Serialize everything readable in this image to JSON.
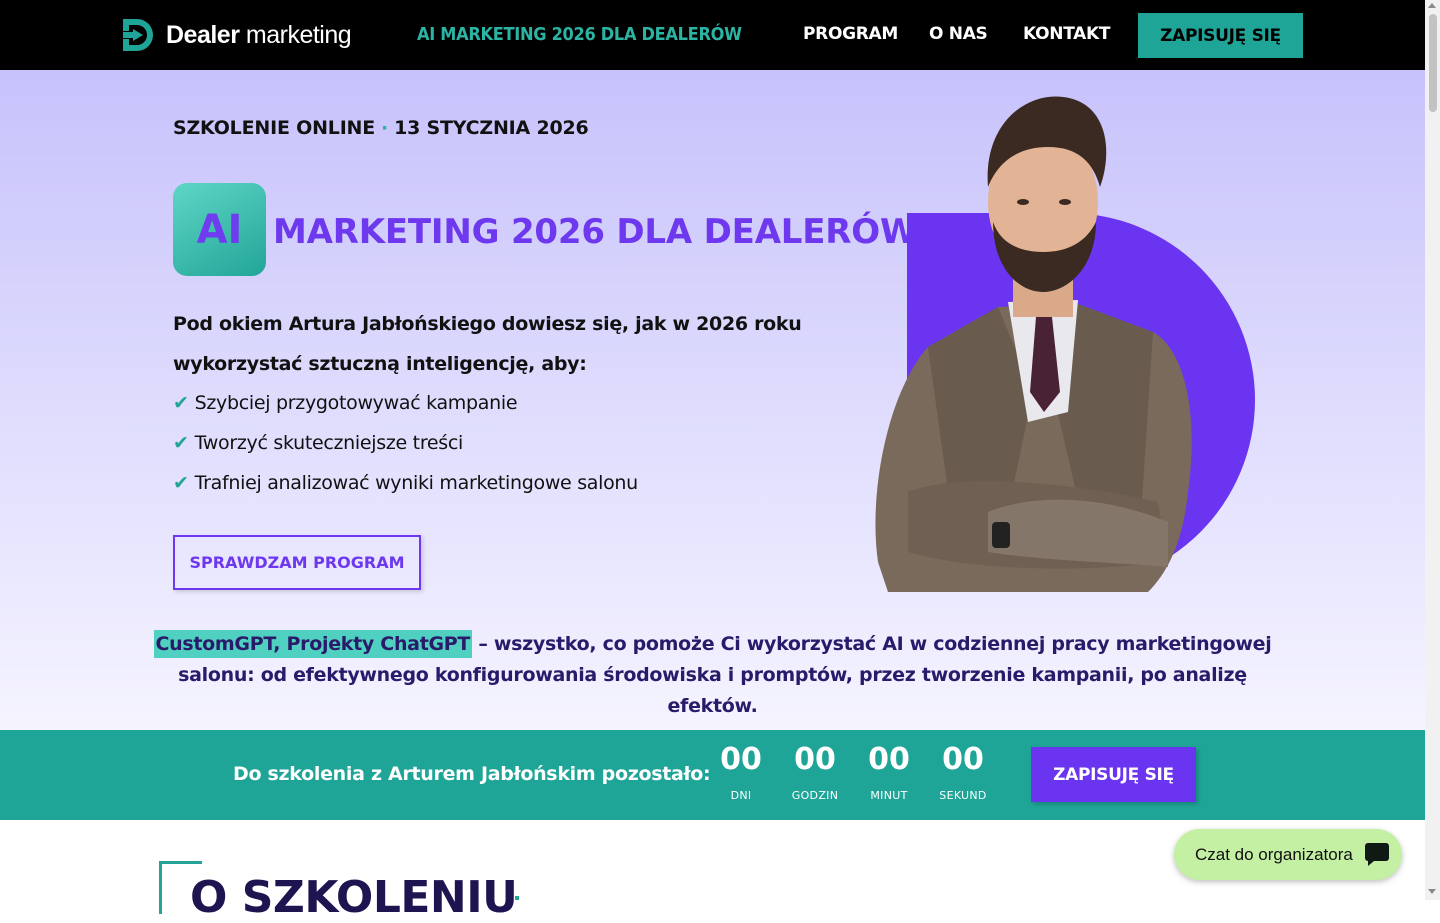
{
  "header": {
    "logo_bold": "Dealer",
    "logo_light": "marketing",
    "center_link": "AI MARKETING 2026 DLA DEALERÓW",
    "nav": [
      "PROGRAM",
      "O NAS",
      "KONTAKT"
    ],
    "cta": "ZAPISUJĘ SIĘ"
  },
  "hero": {
    "eyebrow_left": "SZKOLENIE ONLINE",
    "eyebrow_sep": "·",
    "eyebrow_right": "13 STYCZNIA 2026",
    "badge": "AI",
    "title": "MARKETING 2026 DLA DEALERÓW",
    "lead": "Pod okiem Artura Jabłońskiego dowiesz się, jak w 2026 roku wykorzystać sztuczną inteligencję, aby:",
    "bullet_icon": "✔",
    "bullets": [
      "Szybciej przygotowywać kampanie",
      "Tworzyć skuteczniejsze treści",
      "Trafniej analizować wyniki marketingowe salonu"
    ],
    "program_button": "SPRAWDZAM PROGRAM",
    "tagline_highlight": "CustomGPT, Projekty ChatGPT",
    "tagline_rest": " – wszystko, co pomoże Ci wykorzystać AI w codziennej pracy marketingowej salonu: od efektywnego konfigurowania środowiska i promptów, przez tworzenie kampanii, po analizę efektów."
  },
  "countdown": {
    "label": "Do szkolenia z Arturem Jabłońskim pozostało:",
    "units": [
      {
        "value": "00",
        "caption": "DNI"
      },
      {
        "value": "00",
        "caption": "GODZIN"
      },
      {
        "value": "00",
        "caption": "MINUT"
      },
      {
        "value": "00",
        "caption": "SEKUND"
      }
    ],
    "cta": "ZAPISUJĘ SIĘ"
  },
  "section": {
    "title": "O SZKOLENIU"
  },
  "chat": {
    "label": "Czat do organizatora",
    "icon": "chat-bubble-icon"
  },
  "colors": {
    "header_bg": "#000000",
    "teal": "#1fa597",
    "purple": "#6d38ee",
    "hero_top": "#c7c2fb",
    "chat_bg": "#c3f0a2",
    "navy_text": "#2a1a6a"
  }
}
